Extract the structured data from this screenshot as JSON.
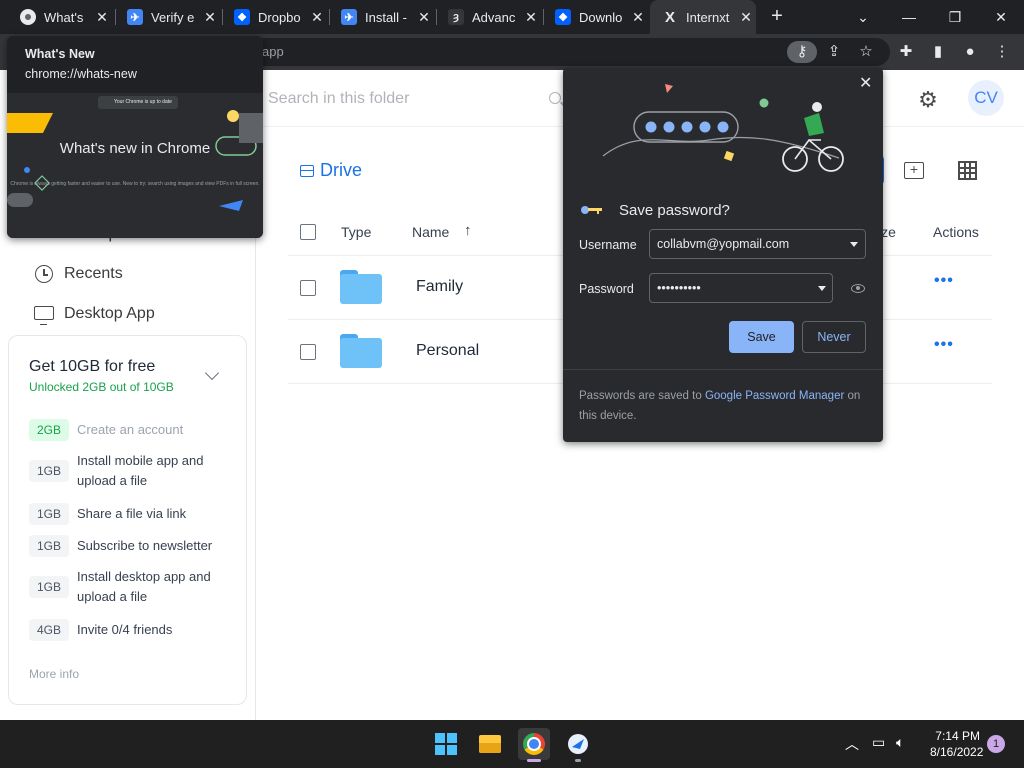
{
  "browser": {
    "tabs": [
      {
        "title": "What's",
        "favicon": "chrome-icon",
        "active": false
      },
      {
        "title": "Verify e",
        "favicon": "internxt-bird-icon",
        "active": false
      },
      {
        "title": "Dropbo",
        "favicon": "dropbox-icon",
        "active": false
      },
      {
        "title": "Install -",
        "favicon": "internxt-bird-icon",
        "active": false
      },
      {
        "title": "Advanc",
        "favicon": "advanced-icon",
        "active": false
      },
      {
        "title": "Downlo",
        "favicon": "dropbox-icon",
        "active": false
      },
      {
        "title": "Internxt",
        "favicon": "internxt-x-icon",
        "active": true
      }
    ],
    "new_tab_glyph": "+",
    "window_controls": {
      "tab_search": "⌄",
      "minimize": "—",
      "restore": "❐",
      "close": "✕"
    },
    "address_fragment": "app"
  },
  "whats_new_tooltip": {
    "title": "What's New",
    "url": "chrome://whats-new",
    "thumb_pill": "Your Chrome is up to date",
    "thumb_heading": "What's new in Chrome",
    "thumb_small": "Chrome is always getting faster and easier to use. New to try: search using images and view PDFs in full screen."
  },
  "sidebar": {
    "partial_item": "Backups",
    "items": [
      {
        "label": "Recents",
        "icon": "clock-icon"
      },
      {
        "label": "Desktop App",
        "icon": "monitor-icon"
      }
    ],
    "promo": {
      "title": "Get 10GB for free",
      "subtitle": "Unlocked 2GB out of 10GB",
      "tasks": [
        {
          "gb": "2GB",
          "text": "Create an account",
          "done": true
        },
        {
          "gb": "1GB",
          "text": "Install mobile app and upload a file",
          "done": false
        },
        {
          "gb": "1GB",
          "text": "Share a file via link",
          "done": false
        },
        {
          "gb": "1GB",
          "text": "Subscribe to newsletter",
          "done": false
        },
        {
          "gb": "1GB",
          "text": "Install desktop app and upload a file",
          "done": false
        },
        {
          "gb": "4GB",
          "text": "Invite 0/4 friends",
          "done": false
        }
      ],
      "more_info": "More info"
    }
  },
  "header": {
    "search_placeholder": "Search in this folder",
    "avatar_initials": "CV"
  },
  "main": {
    "breadcrumb": "Drive",
    "columns": {
      "type": "Type",
      "name": "Name",
      "size_partial": "ize",
      "actions": "Actions"
    },
    "sort_glyph": "↑",
    "rows": [
      {
        "name": "Family",
        "actions_glyph": "•••"
      },
      {
        "name": "Personal",
        "actions_glyph": "•••"
      }
    ]
  },
  "save_password": {
    "title": "Save password?",
    "username_label": "Username",
    "username_value": "collabvm@yopmail.com",
    "password_label": "Password",
    "password_value": "••••••••••",
    "save_label": "Save",
    "never_label": "Never",
    "footer_pre": "Passwords are saved to",
    "footer_link": "Google Password Manager",
    "footer_post": "on this device.",
    "accent_color": "#8ab4f8"
  },
  "taskbar": {
    "time": "7:14 PM",
    "date": "8/16/2022",
    "notification_count": "1"
  }
}
